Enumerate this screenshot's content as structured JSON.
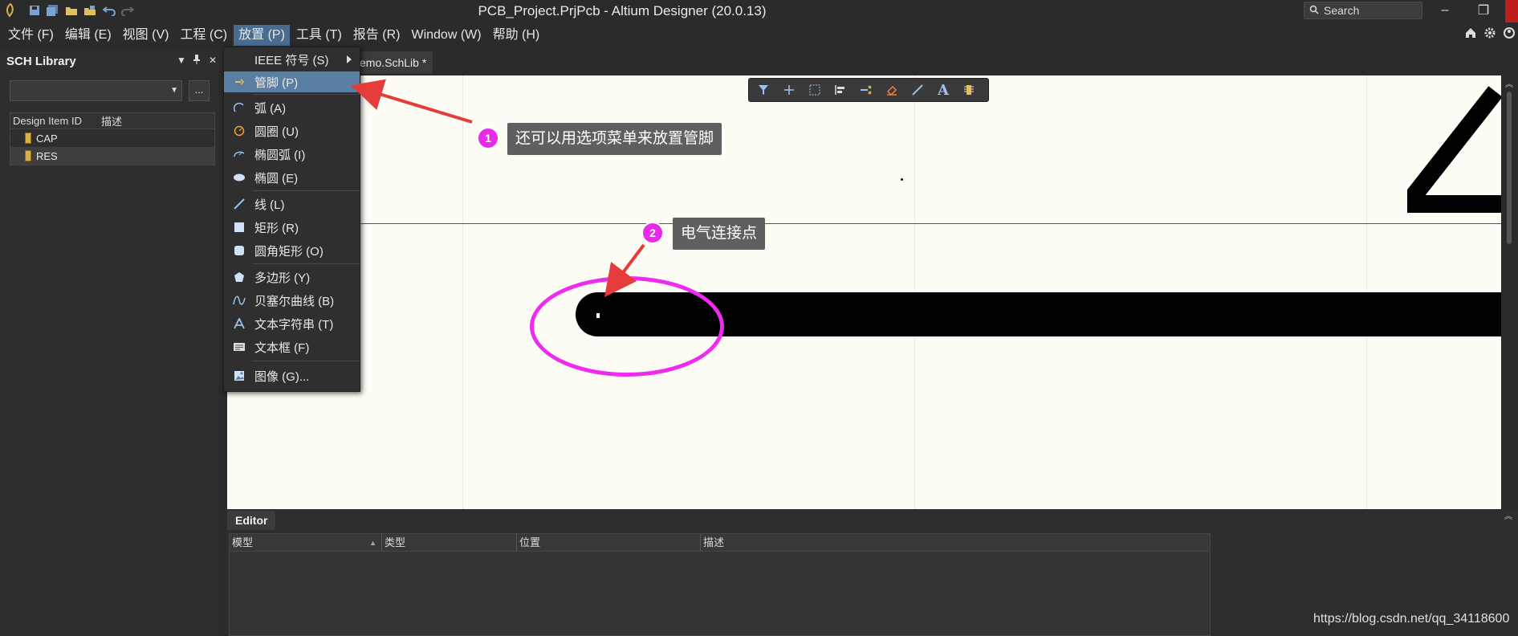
{
  "window": {
    "title": "PCB_Project.PrjPcb - Altium Designer (20.0.13)",
    "search_placeholder": "Search",
    "minimize_glyph": "–",
    "restore_glyph": "❐"
  },
  "menubar": {
    "items": [
      "文件 (F)",
      "编辑 (E)",
      "视图 (V)",
      "工程 (C)",
      "放置 (P)",
      "工具 (T)",
      "报告 (R)",
      "Window (W)",
      "帮助 (H)"
    ],
    "active_index": 4
  },
  "left_panel": {
    "title": "SCH Library",
    "combo_value": "",
    "dots_label": "...",
    "columns": [
      "Design Item ID",
      "描述"
    ],
    "rows": [
      {
        "id": "CAP",
        "desc": ""
      },
      {
        "id": "RES",
        "desc": ""
      }
    ],
    "selected_index": 1
  },
  "doc_tab": {
    "label": "emo.SchLib *"
  },
  "place_menu": {
    "items": [
      {
        "label": "IEEE 符号 (S)",
        "icon": "none",
        "submenu": true
      },
      {
        "label": "管脚 (P)",
        "icon": "pin-icon",
        "highlighted": true
      },
      {
        "label": "弧 (A)",
        "icon": "arc-icon"
      },
      {
        "label": "圆圈 (U)",
        "icon": "full-circle-icon"
      },
      {
        "label": "椭圆弧 (I)",
        "icon": "elliptical-arc-icon"
      },
      {
        "label": "椭圆 (E)",
        "icon": "ellipse-icon"
      },
      {
        "label": "线 (L)",
        "icon": "line-icon"
      },
      {
        "label": "矩形 (R)",
        "icon": "rectangle-icon"
      },
      {
        "label": "圆角矩形 (O)",
        "icon": "round-rectangle-icon"
      },
      {
        "label": "多边形 (Y)",
        "icon": "polygon-icon"
      },
      {
        "label": "贝塞尔曲线 (B)",
        "icon": "bezier-icon"
      },
      {
        "label": "文本字符串 (T)",
        "icon": "text-string-icon"
      },
      {
        "label": "文本框 (F)",
        "icon": "text-frame-icon"
      },
      {
        "label": "图像 (G)...",
        "icon": "image-icon"
      }
    ]
  },
  "active_bar": {
    "tools": [
      "filter-icon",
      "crosshair-icon",
      "select-rect-icon",
      "align-icon",
      "place-pin-icon",
      "eraser-icon",
      "line-tool-icon",
      "text-tool-icon",
      "part-icon"
    ],
    "text_tool_glyph": "A"
  },
  "editor_panel": {
    "tab_label": "Editor",
    "columns": [
      "模型",
      "类型",
      "位置",
      "描述"
    ]
  },
  "callouts": [
    {
      "number": "1",
      "text": "还可以用选项菜单来放置管脚"
    },
    {
      "number": "2",
      "text": "电气连接点"
    }
  ],
  "watermark": "https://blog.csdn.net/qq_34118600",
  "colors": {
    "accent_highlight": "#5b7fa3",
    "annotation_magenta": "#e82ae8",
    "arrow_red": "#e53b3b",
    "canvas": "#fdfcf5"
  }
}
